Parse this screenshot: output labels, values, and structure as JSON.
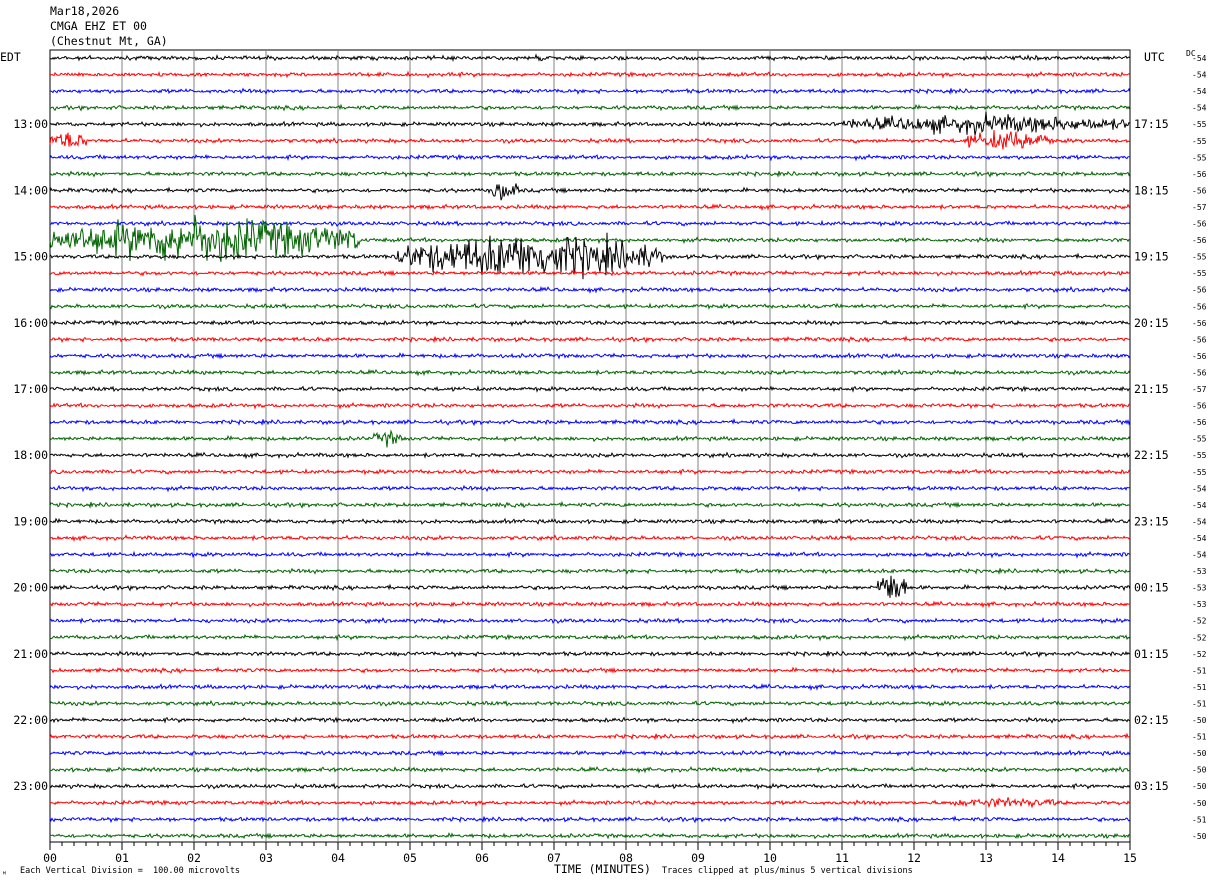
{
  "header": {
    "date": "Mar18,2026",
    "station": "CMGA EHZ ET 00",
    "location": "(Chestnut Mt, GA)"
  },
  "timezones": {
    "left": "EDT",
    "right": "UTC"
  },
  "dc_label": "DC",
  "footer": {
    "scale_note": "Each Vertical Division =  100.00 microvolts",
    "clip_note": "Traces clipped at plus/minus 5 vertical divisions",
    "corner_mark": "ᴹ"
  },
  "trace_colors": [
    "#000000",
    "#ff0000",
    "#0000ff",
    "#006400"
  ],
  "chart_data": {
    "type": "line",
    "title": "",
    "xlabel": "TIME (MINUTES)",
    "x_ticks": [
      "00",
      "01",
      "02",
      "03",
      "04",
      "05",
      "06",
      "07",
      "08",
      "09",
      "10",
      "11",
      "12",
      "13",
      "14",
      "15"
    ],
    "xlim": [
      0,
      15
    ],
    "grid": true,
    "row_count": 48,
    "left_hour_labels": [
      "13:00",
      "14:00",
      "15:00",
      "16:00",
      "17:00",
      "18:00",
      "19:00",
      "20:00",
      "21:00",
      "22:00",
      "23:00"
    ],
    "right_hour_labels": [
      "17:15",
      "18:15",
      "19:15",
      "20:15",
      "21:15",
      "22:15",
      "23:15",
      "00:15",
      "01:15",
      "02:15",
      "03:15"
    ],
    "dc_offsets": [
      "-54",
      "-54",
      "-54",
      "-54",
      "-55",
      "-55",
      "-55",
      "-56",
      "-56",
      "-57",
      "-56",
      "-56",
      "-55",
      "-55",
      "-56",
      "-56",
      "-56",
      "-56",
      "-56",
      "-56",
      "-57",
      "-56",
      "-56",
      "-55",
      "-55",
      "-55",
      "-54",
      "-54",
      "-54",
      "-54",
      "-54",
      "-53",
      "-53",
      "-53",
      "-52",
      "-52",
      "-52",
      "-51",
      "-51",
      "-51",
      "-50",
      "-51",
      "-50",
      "-50",
      "-50",
      "-50",
      "-51",
      "-50"
    ],
    "events": [
      {
        "row": 0,
        "start_min": 6.7,
        "end_min": 6.9,
        "amplitude": 0.4
      },
      {
        "row": 4,
        "start_min": 11.0,
        "end_min": 15.0,
        "amplitude": 0.9
      },
      {
        "row": 5,
        "start_min": 0.0,
        "end_min": 0.5,
        "amplitude": 1.0
      },
      {
        "row": 5,
        "start_min": 12.7,
        "end_min": 13.9,
        "amplitude": 1.1
      },
      {
        "row": 8,
        "start_min": 6.1,
        "end_min": 6.5,
        "amplitude": 1.2
      },
      {
        "row": 11,
        "start_min": 0.0,
        "end_min": 4.3,
        "amplitude": 2.6
      },
      {
        "row": 12,
        "start_min": 4.8,
        "end_min": 8.5,
        "amplitude": 2.6
      },
      {
        "row": 23,
        "start_min": 4.5,
        "end_min": 4.9,
        "amplitude": 0.7
      },
      {
        "row": 32,
        "start_min": 11.5,
        "end_min": 11.9,
        "amplitude": 2.2
      },
      {
        "row": 45,
        "start_min": 12.5,
        "end_min": 14.0,
        "amplitude": 0.4
      }
    ]
  }
}
